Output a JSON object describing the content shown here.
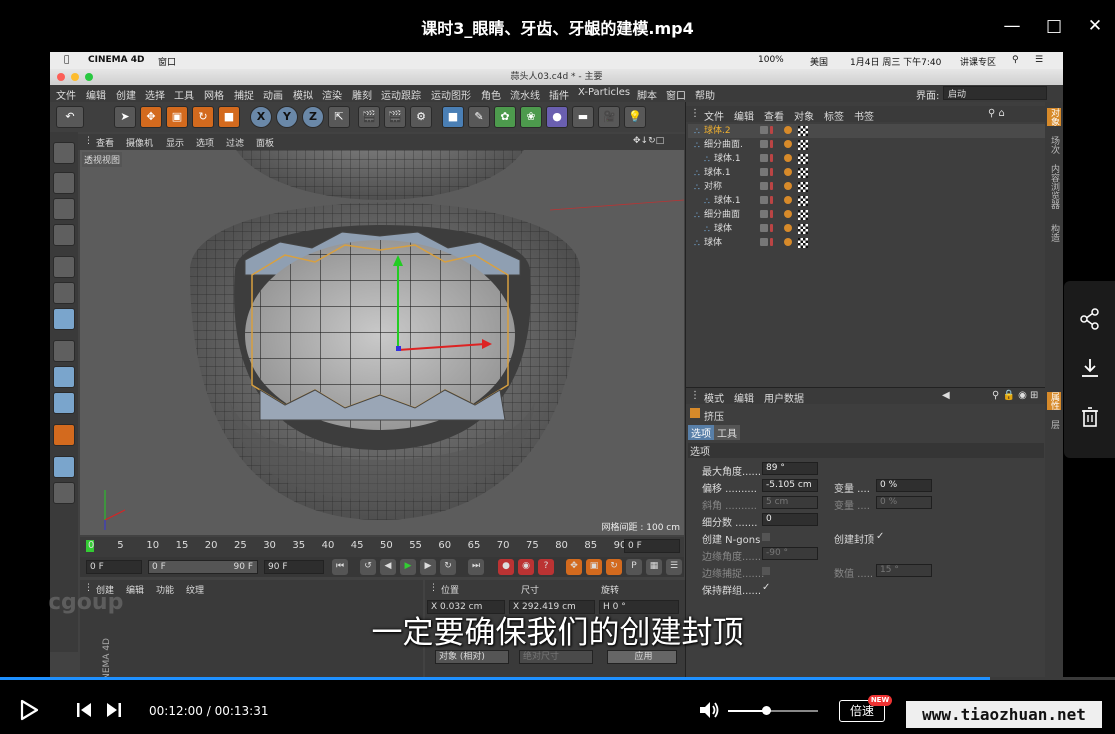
{
  "window": {
    "title": "课时3_眼睛、牙齿、牙龈的建模.mp4",
    "min_icon": "minimize-icon",
    "max_icon": "maximize-icon",
    "close_icon": "close-icon"
  },
  "mac_menubar": {
    "apple": "",
    "app": "CINEMA 4D",
    "window_menu": "窗口",
    "battery": "100%",
    "lang": "美国",
    "datetime": "1月4日 周三 下午7:40",
    "user": "讲课专区"
  },
  "c4d": {
    "doc_title": "蒜头人03.c4d * - 主要",
    "menus": [
      "文件",
      "编辑",
      "创建",
      "选择",
      "工具",
      "网格",
      "捕捉",
      "动画",
      "模拟",
      "渲染",
      "雕刻",
      "运动跟踪",
      "运动图形",
      "角色",
      "流水线",
      "插件",
      "X-Particles",
      "脚本",
      "窗口",
      "帮助"
    ],
    "layout_label": "界面:",
    "layout_value": "启动",
    "viewport_menu": [
      "查看",
      "摄像机",
      "显示",
      "选项",
      "过滤",
      "面板"
    ],
    "viewport_label": "透视视图",
    "grid_spacing": "网格间距 : 100 cm",
    "timeline_ticks": [
      "0",
      "5",
      "10",
      "15",
      "20",
      "25",
      "30",
      "35",
      "40",
      "45",
      "50",
      "55",
      "60",
      "65",
      "70",
      "75",
      "80",
      "85",
      "90"
    ],
    "timeline_end": "0 F",
    "frame_start": "0 F",
    "frame_min": "0 F",
    "frame_max": "90 F",
    "frame_end": "90 F",
    "material_menu": [
      "创建",
      "编辑",
      "功能",
      "纹理"
    ],
    "coords": {
      "headers": [
        "位置",
        "尺寸",
        "旋转"
      ],
      "x_pos": "X  0.032 cm",
      "x_size": "X  292.419 cm",
      "h_rot": "H  0 °",
      "mode": "对象 (相对)",
      "size_mode": "绝对尺寸",
      "apply": "应用"
    },
    "object_manager": {
      "menu": [
        "文件",
        "编辑",
        "查看",
        "对象",
        "标签",
        "书签"
      ],
      "objects": [
        {
          "name": "球体.2",
          "indent": 0,
          "selected": true
        },
        {
          "name": "细分曲面.",
          "indent": 0,
          "selected": false
        },
        {
          "name": "球体.1",
          "indent": 1,
          "selected": false
        },
        {
          "name": "球体.1",
          "indent": 0,
          "selected": false
        },
        {
          "name": "对称",
          "indent": 0,
          "selected": false
        },
        {
          "name": "球体.1",
          "indent": 1,
          "selected": false
        },
        {
          "name": "细分曲面",
          "indent": 0,
          "selected": false
        },
        {
          "name": "球体",
          "indent": 1,
          "selected": false
        },
        {
          "name": "球体",
          "indent": 0,
          "selected": false
        }
      ]
    },
    "attribute_manager": {
      "menu": [
        "模式",
        "编辑",
        "用户数据"
      ],
      "tool_name": "挤压",
      "tabs": [
        "选项",
        "工具"
      ],
      "section": "选项",
      "max_angle_label": "最大角度.......",
      "max_angle": "89 °",
      "offset_label": "偏移 ..........",
      "offset": "-5.105 cm",
      "variance_label": "变量 ....",
      "variance": "0 %",
      "bevel_label": "斜角 ..........",
      "bevel": "5 cm",
      "variance2_label": "变量 ....",
      "variance2": "0 %",
      "subdiv_label": "细分数 .......",
      "subdiv": "0",
      "ngons_label": "创建 N-gons",
      "cap_label": "创建封顶",
      "cap_check": "✓",
      "edge_angle_label": "边缘角度.......",
      "edge_angle": "-90 °",
      "edge_snap_label": "边缘捕捉.......",
      "value_label": "数值 .....",
      "value": "15 °",
      "preserve_label": "保持群组......",
      "preserve_check": "✓"
    },
    "side_tabs": [
      "对象",
      "场次",
      "内容浏览器",
      "构造",
      "属性",
      "层"
    ]
  },
  "subtitle": "一定要确保我们的创建封顶",
  "watermark": "cgoup",
  "maxon": "MAXON CINEMA 4D",
  "player": {
    "time": "00:12:00 / 00:13:31",
    "progress": 0.888,
    "volume": 0.42,
    "speed": "倍速",
    "new_badge": "NEW",
    "site": "www.tiaozhuan.net"
  },
  "sidebar": {
    "share": "share-icon",
    "download": "download-icon",
    "delete": "trash-icon"
  }
}
